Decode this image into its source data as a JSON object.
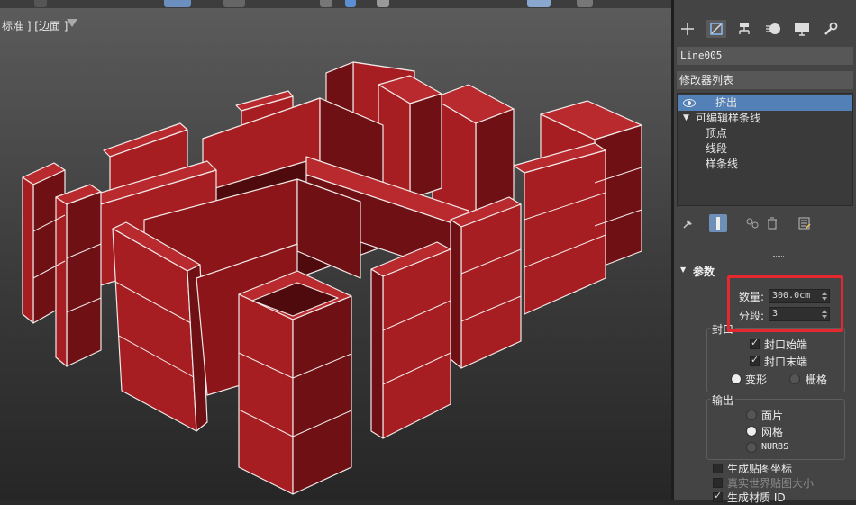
{
  "viewport": {
    "label": "标准 ] [边面 ]",
    "scene_description_icon": "filter-icon"
  },
  "colors": {
    "wall_front": "#a61e22",
    "wall_side": "#6e1014",
    "wall_top": "#b82a2e",
    "edge": "#f2e8e8",
    "selection": "#5480b8",
    "highlight": "#e4282e"
  },
  "command_panel": {
    "tabs": [
      "plus-icon",
      "modify-icon",
      "hierarchy-icon",
      "motion-icon",
      "display-icon",
      "utilities-icon"
    ],
    "object_name": "Line005",
    "modifier_list": "修改器列表",
    "stack": {
      "extrude": "挤出",
      "editable_spline": "可编辑样条线",
      "vertex": "顶点",
      "segment": "线段",
      "spline": "样条线"
    },
    "params": {
      "title": "参数",
      "amount_label": "数量:",
      "amount_value": "300.0cm",
      "segments_label": "分段:",
      "segments_value": "3",
      "capping_group": "封口",
      "cap_start": "封口始端",
      "cap_end": "封口末端",
      "morph": "变形",
      "grid": "栅格",
      "output_group": "输出",
      "patch": "面片",
      "mesh": "网格",
      "nurbs": "NURBS",
      "gen_mapping": "生成贴图坐标",
      "real_world": "真实世界贴图大小",
      "gen_material": "生成材质 ID"
    }
  }
}
